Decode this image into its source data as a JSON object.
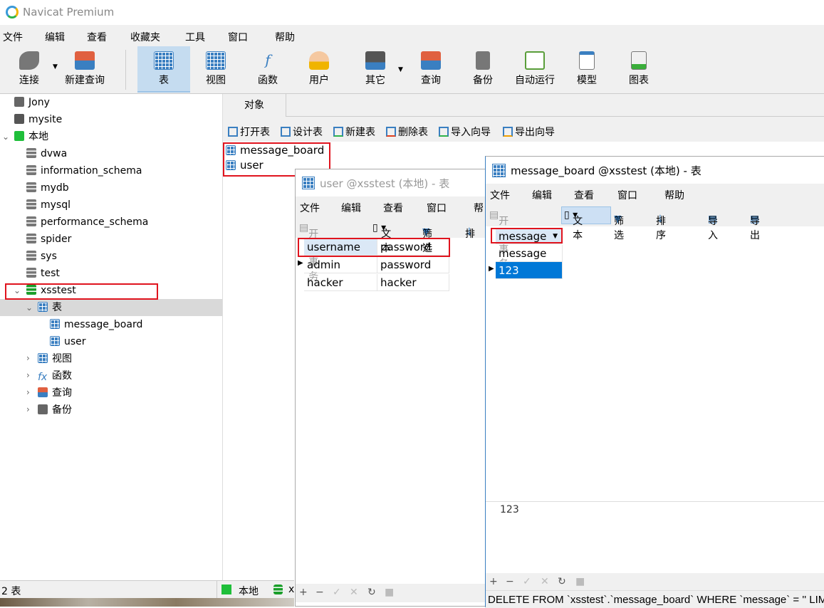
{
  "app": {
    "title": "Navicat Premium"
  },
  "menu": [
    "文件",
    "编辑",
    "查看",
    "收藏夹",
    "工具",
    "窗口",
    "帮助"
  ],
  "toolbar": [
    {
      "label": "连接",
      "icon": "plug-icon"
    },
    {
      "label": "新建查询",
      "icon": "new-query-icon"
    },
    {
      "label": "表",
      "icon": "table-icon",
      "selected": true
    },
    {
      "label": "视图",
      "icon": "view-icon"
    },
    {
      "label": "函数",
      "icon": "function-icon"
    },
    {
      "label": "用户",
      "icon": "user-icon"
    },
    {
      "label": "其它",
      "icon": "tools-icon"
    },
    {
      "label": "查询",
      "icon": "query-icon"
    },
    {
      "label": "备份",
      "icon": "backup-icon"
    },
    {
      "label": "自动运行",
      "icon": "schedule-icon"
    },
    {
      "label": "模型",
      "icon": "model-icon"
    },
    {
      "label": "图表",
      "icon": "chart-icon"
    }
  ],
  "sidebar": {
    "connections": [
      "Jony",
      "mysite",
      "本地"
    ],
    "databases": [
      "dvwa",
      "information_schema",
      "mydb",
      "mysql",
      "performance_schema",
      "spider",
      "sys",
      "test",
      "xsstest"
    ],
    "table_group": "表",
    "tables": [
      "message_board",
      "user"
    ],
    "groups": [
      "视图",
      "函数",
      "查询",
      "备份"
    ]
  },
  "status": {
    "count": "2 表",
    "connection": "本地",
    "db": "x"
  },
  "objects": {
    "tab": "对象",
    "actions": [
      "打开表",
      "设计表",
      "新建表",
      "删除表",
      "导入向导",
      "导出向导"
    ],
    "items": [
      "message_board",
      "user"
    ]
  },
  "user_window": {
    "title": "user @xsstest (本地) - 表",
    "menu": [
      "文件",
      "编辑",
      "查看",
      "窗口",
      "帮"
    ],
    "toolbar": {
      "begin": "开始事务",
      "text": "文本",
      "filter": "筛选",
      "sort": "排"
    },
    "columns": [
      "username",
      "password"
    ],
    "rows": [
      [
        "admin",
        "password"
      ],
      [
        "hacker",
        "hacker"
      ]
    ]
  },
  "mb_window": {
    "title": "message_board @xsstest (本地) - 表",
    "menu": [
      "文件",
      "编辑",
      "查看",
      "窗口",
      "帮助"
    ],
    "toolbar": {
      "begin": "开始事务",
      "text": "文本",
      "filter": "筛选",
      "sort": "排序",
      "import": "导入",
      "export": "导出"
    },
    "column": "message",
    "rows": [
      "message",
      "123"
    ],
    "preview": "123",
    "sql": "DELETE FROM `xsstest`.`message_board` WHERE `message` = '' LIMIT"
  },
  "colors": {
    "accent": "#0078d7",
    "highlight": "#e0141e",
    "selected_tool": "#c5dcf0"
  }
}
